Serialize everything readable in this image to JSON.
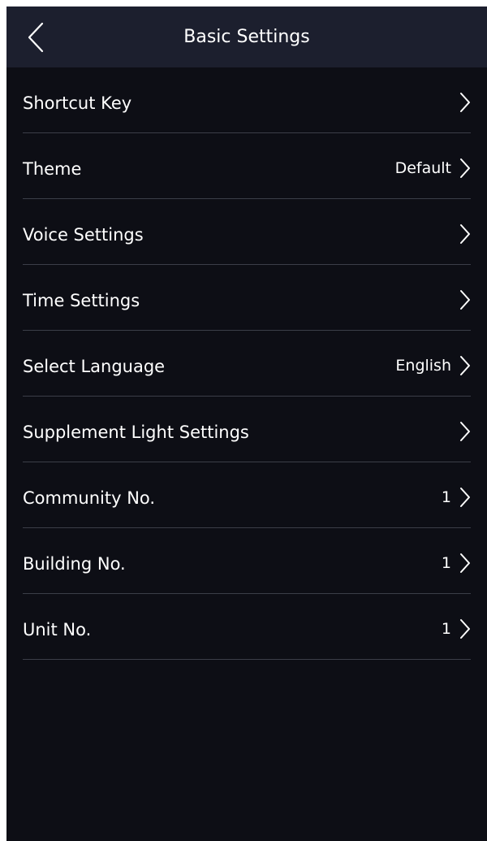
{
  "header": {
    "title": "Basic Settings",
    "back_icon": "chevron-left-icon"
  },
  "colors": {
    "background": "#0d0e15",
    "header": "#1c1f2e",
    "divider": "#3b3e48",
    "text": "#ffffff"
  },
  "items": [
    {
      "label": "Shortcut Key",
      "value": "",
      "icon": "chevron-right-icon"
    },
    {
      "label": "Theme",
      "value": "Default",
      "icon": "chevron-right-icon"
    },
    {
      "label": "Voice Settings",
      "value": "",
      "icon": "chevron-right-icon"
    },
    {
      "label": "Time Settings",
      "value": "",
      "icon": "chevron-right-icon"
    },
    {
      "label": "Select Language",
      "value": "English",
      "icon": "chevron-right-icon"
    },
    {
      "label": "Supplement Light Settings",
      "value": "",
      "icon": "chevron-right-icon"
    },
    {
      "label": "Community No.",
      "value": "1",
      "icon": "chevron-right-icon"
    },
    {
      "label": "Building No.",
      "value": "1",
      "icon": "chevron-right-icon"
    },
    {
      "label": "Unit No.",
      "value": "1",
      "icon": "chevron-right-icon"
    }
  ]
}
